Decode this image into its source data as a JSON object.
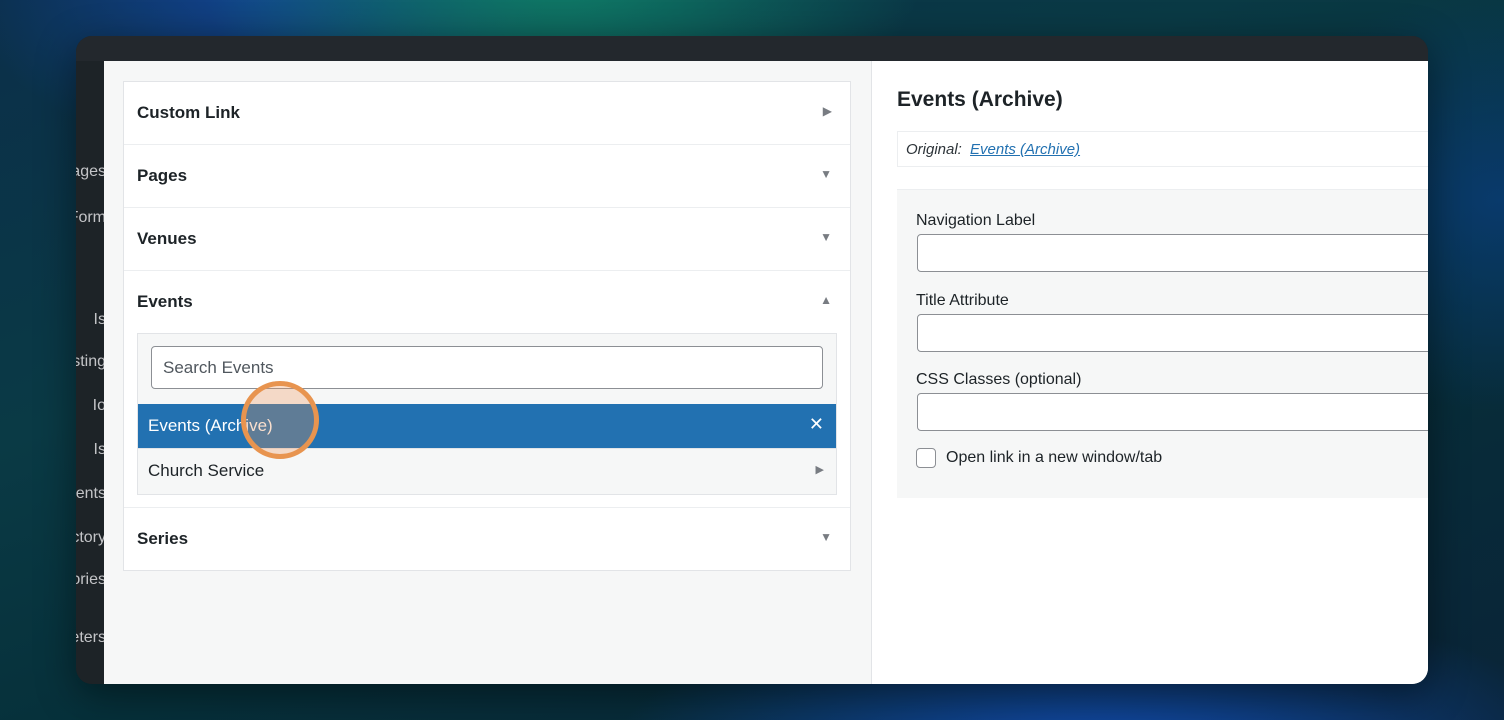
{
  "admin_sidebar": {
    "items": [
      "Pages",
      "Form",
      "Is",
      "Posting",
      "Io",
      "Is",
      "Comments",
      "Directory",
      "Categories",
      "Parameters"
    ]
  },
  "accordion": {
    "sections": [
      {
        "title": "Custom Link",
        "state": "collapsed"
      },
      {
        "title": "Pages",
        "state": "collapsed"
      },
      {
        "title": "Venues",
        "state": "collapsed"
      },
      {
        "title": "Events",
        "state": "expanded"
      },
      {
        "title": "Series",
        "state": "collapsed"
      }
    ],
    "events": {
      "search_placeholder": "Search Events",
      "results": [
        {
          "label": "Events (Archive)",
          "selected": true,
          "action_icon": "close-icon",
          "action_glyph": "✕"
        },
        {
          "label": "Church Service",
          "selected": false,
          "action_icon": "triangle-right-icon",
          "action_glyph": "▶"
        }
      ]
    },
    "arrow_glyphs": {
      "collapsed_first": "▶",
      "collapsed": "▼",
      "expanded": "▲"
    }
  },
  "panel": {
    "title": "Events (Archive)",
    "original_label": "Original:",
    "original_link": "Events (Archive)",
    "fields": {
      "navigation_label": "Navigation Label",
      "title_attribute": "Title Attribute",
      "css_classes": "CSS Classes (optional)"
    },
    "checkbox_label": "Open link in a new window/tab",
    "checkbox_checked": false
  },
  "colors": {
    "selected_bg": "#2271b1",
    "link": "#2271b1",
    "cursor_highlight": "#e8944f"
  }
}
